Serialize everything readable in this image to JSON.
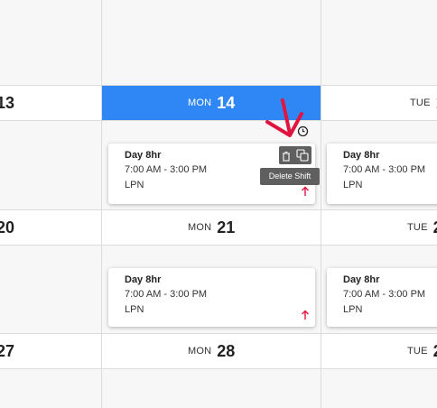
{
  "calendar": {
    "weeks": [
      {
        "left_date": "13",
        "mon": {
          "name": "MON",
          "num": "14",
          "active": true
        },
        "tue": {
          "name": "TUE",
          "num": "1"
        }
      },
      {
        "left_date": "20",
        "mon": {
          "name": "MON",
          "num": "21",
          "active": false
        },
        "tue": {
          "name": "TUE",
          "num": "2"
        }
      },
      {
        "left_date": "27",
        "mon": {
          "name": "MON",
          "num": "28",
          "active": false
        },
        "tue": {
          "name": "TUE",
          "num": "2"
        }
      }
    ],
    "shifts": [
      {
        "title": "Day 8hr",
        "time": "7:00 AM - 3:00 PM",
        "role": "LPN"
      },
      {
        "title": "Day 8hr",
        "time": "7:00 AM - 3:00 PM",
        "role": "LPN"
      },
      {
        "title": "Day 8hr",
        "time": "7:00 AM - 3:00 PM",
        "role": "LPN"
      },
      {
        "title": "Day 8hr",
        "time": "7:00 AM - 3:00 PM",
        "role": "LPN"
      }
    ],
    "tooltip": "Delete Shift",
    "icons": {
      "clock": "clock-icon",
      "trash": "trash-icon",
      "copy": "copy-icon",
      "up_arrow": "arrow-up-icon",
      "annotation_arrow": "annotation-arrow-icon"
    },
    "colors": {
      "accent": "#2f87f6",
      "arrow": "#e0153f",
      "tooltip_bg": "#5f5f5f"
    }
  }
}
